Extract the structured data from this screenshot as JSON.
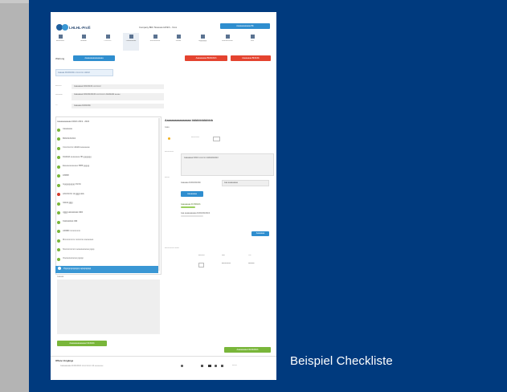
{
  "caption": "Beispiel Checkliste",
  "app": {
    "logo_text": "LHLHL-Profi",
    "header_title": "Company Bbb Tsssssss Hhhhh - Xxxx",
    "header_button": "Aaaaaaaaaaaa Bb",
    "nav": [
      "Aaaaaaaa",
      "Bbbbbb",
      "Cccccccc",
      "Dddddddddd",
      "Eeeeeeeeee",
      "Ffffffffff",
      "Gggggggg",
      "Hhhhhhhhhhh",
      "Iiiiiiii"
    ],
    "toolbar_label": "Wartung",
    "toolbar_primary": "Aaaaaaaaaaaaaaaa",
    "toolbar_red_1": "Aaaaaaaaa Bbbbbbbb",
    "toolbar_red_2": "Aaaaaaaa Bbbbbb",
    "info_banner": "Aaaaaa bbbbbbbbb ccccccccc ddddd",
    "fields": [
      {
        "label": "Aaaaaa",
        "value": "Aaaaaaaa bbbbbbbbb cccccccc"
      },
      {
        "label": "Bbbbbbb",
        "value": "Aaaaaaaa bbbbbbbbbbbb ccccccccc dddddddd eeeee"
      },
      {
        "label": "Cc",
        "value": "Aaaaaaa bbbbbbbb"
      }
    ],
    "list_header": "Aaaaaaaaaaaa bbbbb 2019 - 2022",
    "checklist": [
      {
        "text": "Aaaaaaaa",
        "status": "green"
      },
      {
        "text": "Bbbbbbbbbbb",
        "status": "green"
      },
      {
        "text": "Cccccccccc ddddd eeeeeeee",
        "status": "green"
      },
      {
        "text": "Dddddd eeeeeeee ffff ggggggg",
        "status": "green"
      },
      {
        "text": "Eeeeeeeeeeeee ffffffff ggggg",
        "status": "green"
      },
      {
        "text": "Ffffffffff",
        "status": "green"
      },
      {
        "text": "Gggggggggg hhhhh",
        "status": "green"
      },
      {
        "text": "Hhhhhhhh iiiii jjjjjjjj kkkk",
        "status": "red"
      },
      {
        "text": "Iiiiiiiiiiii jjjjjjjj",
        "status": "green"
      },
      {
        "text": "Jjjjjjjjj kkkkkkkkkk llllllll",
        "status": "green"
      },
      {
        "text": "Kkkkkkkkkk lllllll",
        "status": "green"
      },
      {
        "text": "Lllllllllllll mmmmmm",
        "status": "green"
      },
      {
        "text": "Mmmmmmm nnnnnnn oooooooo",
        "status": "green"
      },
      {
        "text": "Nnnnnnnnnnn ooooooooooo pppp",
        "status": "green"
      },
      {
        "text": "Oooooooooooo ppppp",
        "status": "green"
      },
      {
        "text": "Pppppppppppppp qqqqqqqqq",
        "status": "selected"
      }
    ],
    "notes_label": "Aaaaaa",
    "left_green_button": "Aaaaaaaaaaaaaa bbbbbbb",
    "right_title": "Aaaaaaaaaaaaaaaa bbbbbbbbbbbb",
    "right_sub": "Aaaa",
    "right_small_label": "Aaaaaaaa",
    "right_desc_label": "Aaaaaaaaa",
    "right_desc_text": "Aaaaaaaa bbbbb ccccccc ddddddddddd",
    "right_field_label": "Aaaaa",
    "right_field_value": "Aaaaaaa bbbbbbbbbbb",
    "right_field_value2": "Aaa aaaaaaaaa",
    "right_blue_button": "Aaaaaaaa",
    "right_status_1": "Aaaaaaaaa bb Bbbbbb",
    "right_status_2": "Aaa aaaaaaaaaaa bbbbbbbbbbbb",
    "right_small_blue": "Aaaaaaa",
    "right_table_headers": [
      "Aaaaaa",
      "Bbb",
      "Ccc"
    ],
    "right_table_row": [
      "Aaaaaaaaa",
      "Bbbbbb"
    ],
    "right_side_label": "Aaaaaaaaaa bbbbb",
    "bottom_green_button": "Aaaaaaaaa bbbbbbbbb",
    "footer_label": "Offene Vorgänge",
    "footer_text": "Aaaaaaaaaa bbbbbbbbb cccccccccc dd eeeeeeee",
    "footer_right": "Aaaaa"
  },
  "colors": {
    "panel": "#003a7e",
    "app_blue": "#2f8ecf",
    "app_red": "#e4432f",
    "app_green": "#79b63a",
    "app_selected": "#3a97d4"
  }
}
